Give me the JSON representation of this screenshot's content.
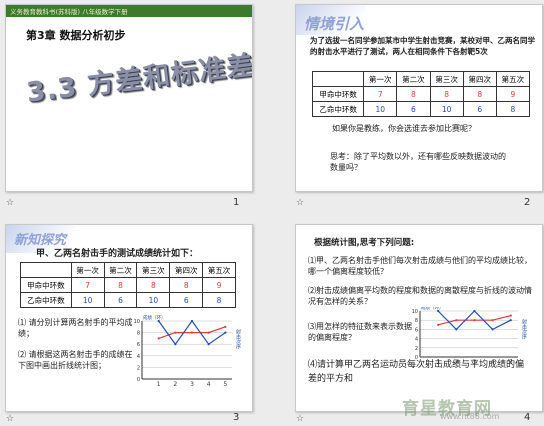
{
  "slides": [
    {
      "number": "1",
      "banner": "义务教育教科书(苏科版) 八年级数学下册",
      "chapter": "第3章  数据分析初步",
      "title": "3.3 方差和标准差"
    },
    {
      "number": "2",
      "heading": "情境引入",
      "intro": "为了选拔一名同学参加某市中学生射击竞赛，某校对甲、乙两名同学的射击水平进行了测试，两人在相同条件下各射靶5次",
      "table": {
        "headers": [
          "",
          "第一次",
          "第二次",
          "第三次",
          "第四次",
          "第五次"
        ],
        "rows": [
          {
            "label": "甲命中环数",
            "values": [
              "7",
              "8",
              "8",
              "8",
              "9"
            ]
          },
          {
            "label": "乙命中环数",
            "values": [
              "10",
              "6",
              "10",
              "6",
              "8"
            ]
          }
        ]
      },
      "q1": "如果你是教练，你会选谁去参加比赛呢？",
      "q2": "思考：除了平均数以外，还有哪些反映数据波动的数量吗？"
    },
    {
      "number": "3",
      "heading": "新知探究",
      "intro": "甲、乙两名射击手的测试成绩统计如下：",
      "table": {
        "headers": [
          "",
          "第一次",
          "第二次",
          "第三次",
          "第四次",
          "第五次"
        ],
        "rows": [
          {
            "label": "甲命中环数",
            "values": [
              "7",
              "8",
              "8",
              "8",
              "9"
            ]
          },
          {
            "label": "乙命中环数",
            "values": [
              "10",
              "6",
              "10",
              "6",
              "8"
            ]
          }
        ]
      },
      "q1": "⑴ 请分别计算两名射手的平均成绩；",
      "q2": "⑵ 请根据这两名射击手的成绩在下图中画出折线统计图；",
      "chart": {
        "ylabel": "成绩（环）",
        "xlabel": "射击次序",
        "yticks": [
          "10",
          "8",
          "6",
          "4",
          "2",
          "0"
        ],
        "xticks": [
          "1",
          "2",
          "3",
          "4",
          "5"
        ]
      }
    },
    {
      "number": "4",
      "intro": "根据统计图,思考下列问题:",
      "q1": "⑴甲、乙两名射击手他们每次射击成绩与他们的平均成绩比较，哪一个偏离程度较低？",
      "q2": "⑵射击成绩偏离平均数的程度和数据的离散程度与折线的波动情况有怎样的关系？",
      "q3": "⑶用怎样的特征数来表示数据的偏离程度？",
      "q4": "⑷请计算甲乙两名运动员每次射击成绩与平均成绩的偏差的平方和",
      "chart": {
        "ylabel": "成绩（环）",
        "xlabel": "射击次序",
        "yticks": [
          "10",
          "8",
          "6",
          "4",
          "2",
          "0"
        ],
        "xticks": [
          "1",
          "2",
          "3",
          "4",
          "5"
        ]
      }
    }
  ],
  "watermark": "育星教育网",
  "watermark_url": "www.ht88.com",
  "colors": {
    "banner": "#3c7a2c",
    "title_gray": "#8a8fa6",
    "heading_blue": "#8fa2d8"
  }
}
